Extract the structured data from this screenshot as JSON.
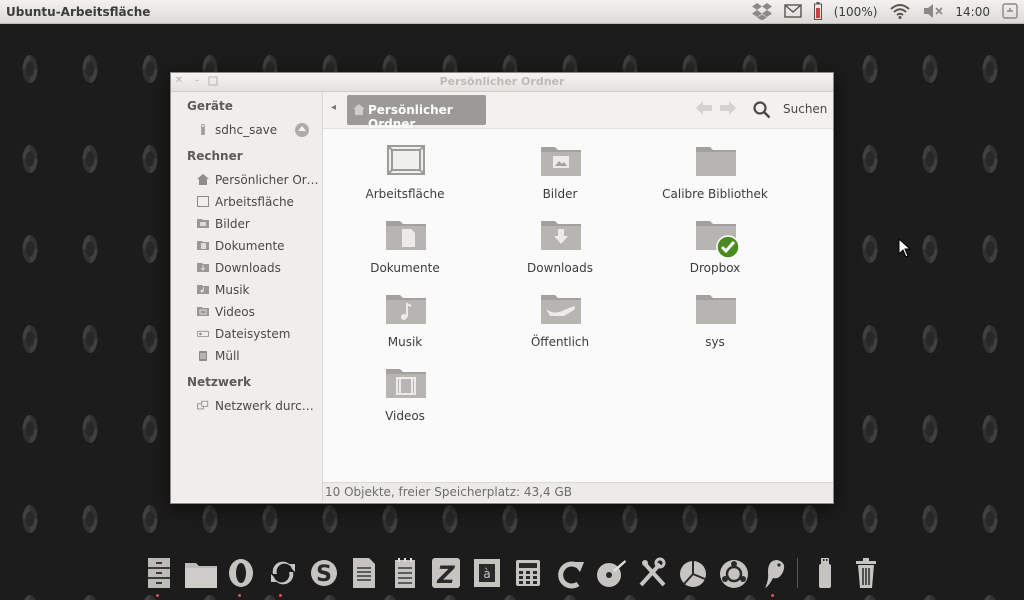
{
  "top_panel": {
    "title": "Ubuntu-Arbeitsfläche",
    "indicators": [
      {
        "icon": "dropbox-icon"
      },
      {
        "icon": "mail-icon"
      },
      {
        "icon": "battery-icon"
      },
      {
        "text": "(100%)"
      },
      {
        "icon": "wifi-icon"
      },
      {
        "icon": "volume-muted-icon"
      },
      {
        "text": "14:00"
      },
      {
        "icon": "session-icon"
      }
    ],
    "battery": "(100%)",
    "clock": "14:00"
  },
  "window": {
    "title": "Persönlicher Ordner",
    "sidebar": {
      "sections": [
        {
          "heading": "Geräte",
          "items": [
            {
              "label": "sdhc_save",
              "icon": "usb-drive-icon",
              "eject": true
            }
          ]
        },
        {
          "heading": "Rechner",
          "items": [
            {
              "label": "Persönlicher Ordner",
              "icon": "home-icon"
            },
            {
              "label": "Arbeitsfläche",
              "icon": "desktop-icon"
            },
            {
              "label": "Bilder",
              "icon": "pictures-folder-icon"
            },
            {
              "label": "Dokumente",
              "icon": "documents-folder-icon"
            },
            {
              "label": "Downloads",
              "icon": "downloads-folder-icon"
            },
            {
              "label": "Musik",
              "icon": "music-folder-icon"
            },
            {
              "label": "Videos",
              "icon": "videos-folder-icon"
            },
            {
              "label": "Dateisystem",
              "icon": "harddisk-icon"
            },
            {
              "label": "Müll",
              "icon": "trash-icon"
            }
          ]
        },
        {
          "heading": "Netzwerk",
          "items": [
            {
              "label": "Netzwerk durchsuchen",
              "icon": "network-icon"
            }
          ]
        }
      ]
    },
    "toolbar": {
      "breadcrumb": "Persönlicher Ordner",
      "search_label": "Suchen"
    },
    "files": [
      {
        "label": "Arbeitsfläche",
        "icon": "desktop-folder-icon"
      },
      {
        "label": "Bilder",
        "icon": "pictures-folder-icon"
      },
      {
        "label": "Calibre Bibliothek",
        "icon": "folder-icon"
      },
      {
        "label": "Dokumente",
        "icon": "documents-folder-icon"
      },
      {
        "label": "Downloads",
        "icon": "downloads-folder-icon"
      },
      {
        "label": "Dropbox",
        "icon": "dropbox-folder-synced-icon"
      },
      {
        "label": "Musik",
        "icon": "music-folder-icon"
      },
      {
        "label": "Öffentlich",
        "icon": "public-folder-icon"
      },
      {
        "label": "sys",
        "icon": "folder-icon"
      },
      {
        "label": "Videos",
        "icon": "videos-folder-icon"
      }
    ],
    "status": "10 Objekte, freier Speicherplatz: 43,4 GB"
  },
  "dock": {
    "items": [
      {
        "icon": "file-cabinet-icon",
        "running": true
      },
      {
        "icon": "files-folder-icon",
        "running": false
      },
      {
        "icon": "opera-icon",
        "running": true
      },
      {
        "icon": "sync-icon",
        "running": true
      },
      {
        "icon": "skype-icon",
        "running": false
      },
      {
        "icon": "document-writer-icon",
        "running": false
      },
      {
        "icon": "notepad-icon",
        "running": false
      },
      {
        "icon": "filezilla-icon",
        "running": false
      },
      {
        "icon": "character-map-icon",
        "running": false
      },
      {
        "icon": "calculator-icon",
        "running": false
      },
      {
        "icon": "redo-arrow-icon",
        "running": false
      },
      {
        "icon": "disc-burner-icon",
        "running": false
      },
      {
        "icon": "system-tools-icon",
        "running": false
      },
      {
        "icon": "disk-usage-icon",
        "running": false
      },
      {
        "icon": "ubuntu-software-icon",
        "running": false
      },
      {
        "icon": "pidgin-icon",
        "running": true
      },
      {
        "icon": "usb-stick-icon",
        "running": false
      },
      {
        "icon": "trash-icon",
        "running": false
      }
    ]
  }
}
